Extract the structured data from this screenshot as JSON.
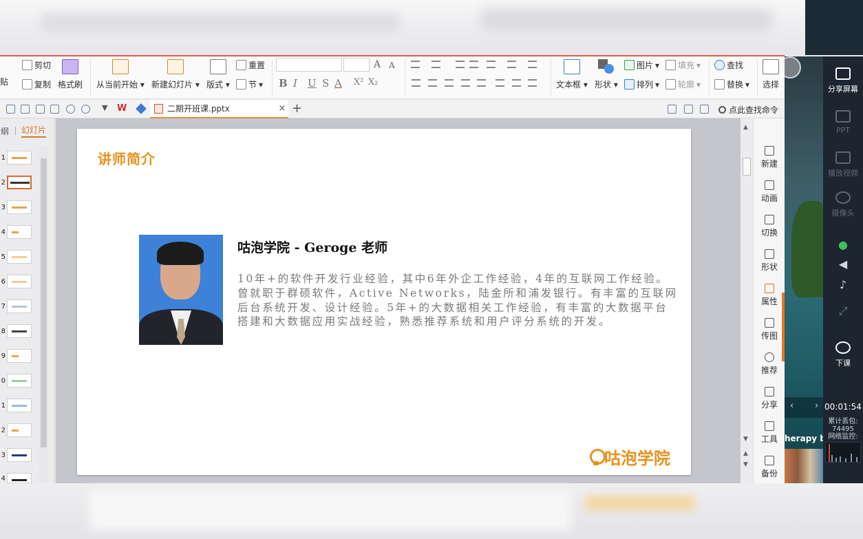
{
  "ribbon": {
    "paste": "贴",
    "cut": "剪切",
    "copy": "复制",
    "format_painter": "格式刷",
    "from_current": "从当前开始",
    "new_slide": "新建幻灯片",
    "layout": "版式",
    "reset": "重置",
    "section": "节",
    "text_box": "文本框",
    "shape": "形状",
    "picture": "图片",
    "fill": "填充",
    "arrange": "排列",
    "outline": "轮廓",
    "find": "查找",
    "replace": "替换",
    "select": "选择",
    "font_grow": "A",
    "font_shrink": "A",
    "bold": "B",
    "italic": "I",
    "underline": "U",
    "strike": "S",
    "font_color": "A",
    "superscript": "X²",
    "subscript": "X₂"
  },
  "tabs": {
    "wps_logo": "W",
    "document_name": "二期开班课.pptx",
    "close": "×",
    "add": "+",
    "search_commands": "点此查找命令"
  },
  "left_panel": {
    "tab_outline": "纲",
    "tab_slides": "幻灯片",
    "slide_numbers": [
      "1",
      "2",
      "3",
      "4",
      "5",
      "6",
      "7",
      "8",
      "9",
      "0",
      "1",
      "2",
      "3",
      "4"
    ]
  },
  "slide": {
    "title": "讲师简介",
    "name_line": "咕泡学院  -  Geroge 老师",
    "bio": "10年+的软件开发行业经验，其中6年外企工作经验，4年的互联网工作经验。曾就职于群硕软件，Active Networks，陆金所和浦发银行。有丰富的互联网后台系统开发、设计经验。5年+的大数据相关工作经验，有丰富的大数据平台搭建和大数据应用实战经验，熟悉推荐系统和用户评分系统的开发。",
    "logo_text": "咕泡学院"
  },
  "right_bar": {
    "items": [
      "新建",
      "动画",
      "切换",
      "形状",
      "属性",
      "传图",
      "推荐",
      "分享",
      "工具",
      "备份"
    ]
  },
  "video": {
    "caption": "herapy ba",
    "prev": "‹",
    "next": "›"
  },
  "side_panel": {
    "share_screen": "分享屏幕",
    "ppt": "PPT",
    "play_video": "播放视频",
    "camera": "摄像头",
    "end_class": "下课",
    "timer": "00:01:54",
    "lost_packets_label": "累计丢包:",
    "lost_packets_value": "74495",
    "network_monitor": "网络监控:"
  }
}
